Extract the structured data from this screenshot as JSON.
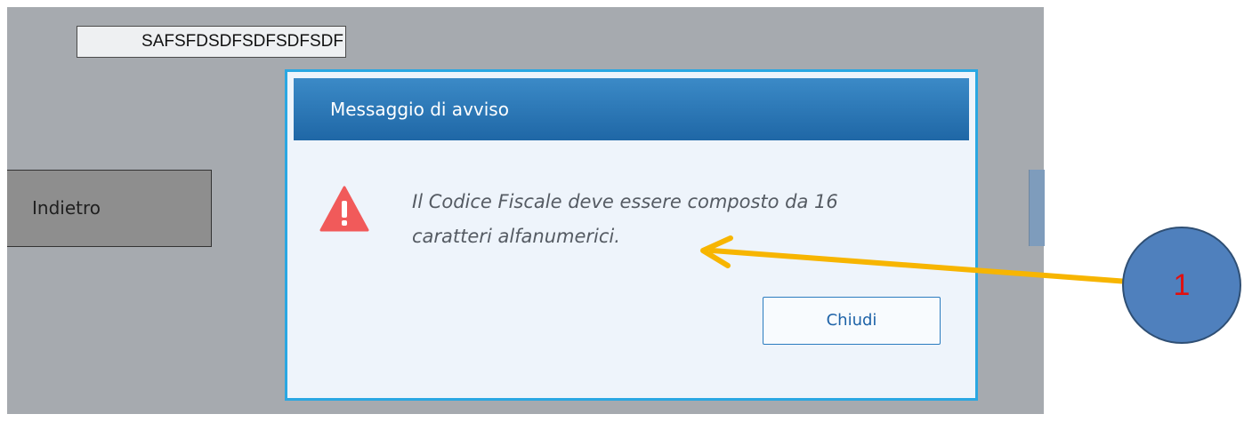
{
  "form": {
    "codice_fiscale_value": "SAFSFDSDFSDFSDFSDF"
  },
  "buttons": {
    "back_label": "Indietro"
  },
  "dialog": {
    "title": "Messaggio di avviso",
    "message_line1": "Il Codice Fiscale deve essere composto da 16",
    "message_line2": "caratteri alfanumerici.",
    "close_label": "Chiudi",
    "icon": "warning-triangle-icon"
  },
  "annotation": {
    "callout_label": "1"
  },
  "colors": {
    "background": "#a6aaaf",
    "dialog_border": "#2aa7e2",
    "dialog_header": "#1f67a6",
    "warning_icon": "#f15a5a",
    "arrow": "#f7b500",
    "callout_fill": "#4f80bd",
    "callout_text": "#e01010"
  }
}
